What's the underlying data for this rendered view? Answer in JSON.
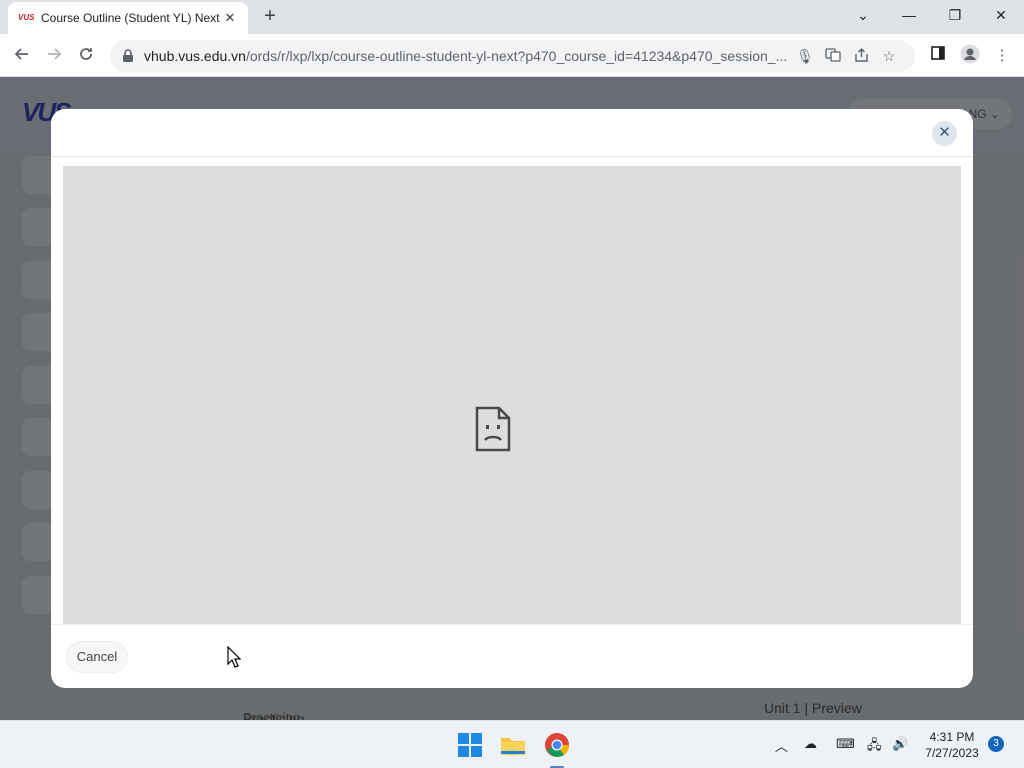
{
  "browser": {
    "tab_title": "Course Outline (Student YL) Next",
    "tab_favicon_text": "VUS",
    "tab_close": "✕",
    "new_tab": "+",
    "url_host": "vhub.vus.edu.vn",
    "url_path": "/ords/r/lxp/lxp/course-outline-student-yl-next?p470_course_id=41234&p470_session_...",
    "window_controls": {
      "minimize": "—",
      "maximize": "❐",
      "close": "✕",
      "tab_search": "⌄"
    }
  },
  "page": {
    "logo": "VUS",
    "user_name": "ANG ⌄",
    "practicing_label": "Practicing",
    "unit_label": "Unit 1 | Preview"
  },
  "modal": {
    "close_label": "✕",
    "cancel_label": "Cancel",
    "frame_status_icon": "sad-file-icon"
  },
  "taskbar": {
    "time": "4:31 PM",
    "date": "7/27/2023",
    "notification_count": "3"
  },
  "colors": {
    "overlay": "#8d9196",
    "frame_bg": "#dddddd",
    "close_btn_bg": "#dde6ee",
    "chrome_tabstrip": "#dee1e6"
  }
}
